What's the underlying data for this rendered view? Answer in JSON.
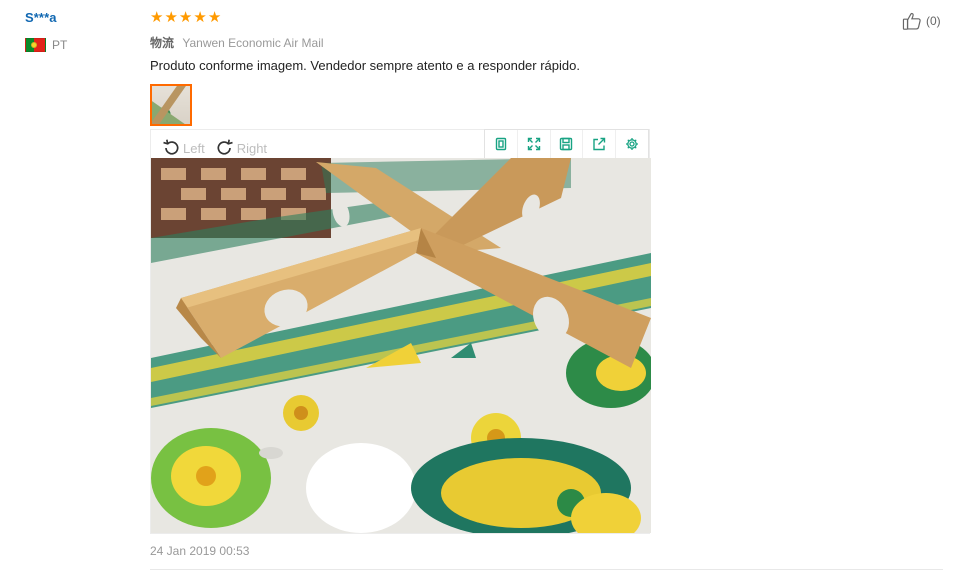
{
  "reviewer": {
    "name": "S***a",
    "country_code": "PT",
    "flag_icon": "portugal-flag-icon"
  },
  "rating": {
    "stars": 5,
    "max": 5,
    "star_glyph": "★",
    "color": "#ff9a00"
  },
  "logistics": {
    "label": "物流",
    "value": "Yanwen Economic Air Mail"
  },
  "review": {
    "text": "Produto conforme imagem. Vendedor sempre atento e a responder rápido.",
    "date": "24 Jan 2019 00:53"
  },
  "viewer": {
    "rotate_left_label": "Left",
    "rotate_right_label": "Right",
    "tools": [
      "original-size-icon",
      "fullscreen-icon",
      "save-icon",
      "share-icon",
      "settings-icon"
    ],
    "accent_color": "#18a383"
  },
  "helpful": {
    "count": "(0)",
    "icon": "thumbs-up-icon"
  },
  "colors": {
    "link_blue": "#1168b2",
    "selection_orange": "#ff6a00"
  }
}
